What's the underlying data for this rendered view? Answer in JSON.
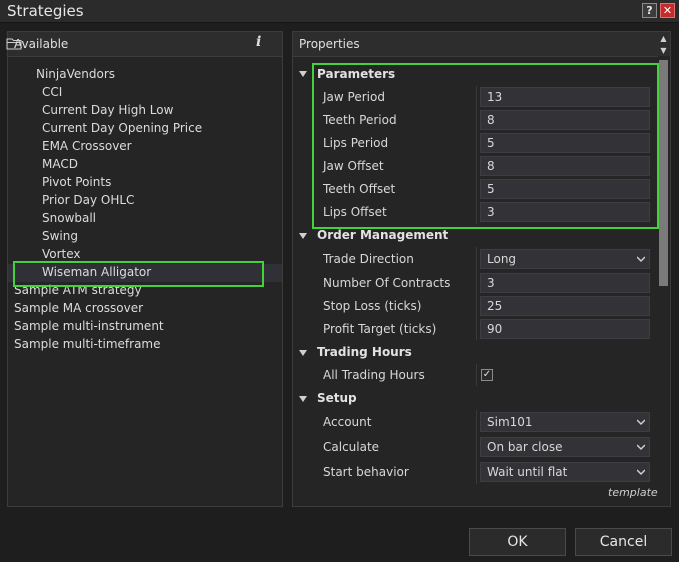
{
  "window": {
    "title": "Strategies",
    "help_label": "?",
    "close_label": "✕"
  },
  "available": {
    "header": "Available",
    "info_label": "i",
    "folder": "NinjaVendors",
    "folder_items": [
      "CCI",
      "Current Day High Low",
      "Current Day Opening Price",
      "EMA Crossover",
      "MACD",
      "Pivot Points",
      "Prior Day OHLC",
      "Snowball",
      "Swing",
      "Vortex",
      "Wiseman Alligator"
    ],
    "root_items": [
      "Sample ATM strategy",
      "Sample MA crossover",
      "Sample multi-instrument",
      "Sample multi-timeframe"
    ],
    "selected": "Wiseman Alligator"
  },
  "properties": {
    "header": "Properties",
    "sections": {
      "parameters": {
        "title": "Parameters",
        "rows": [
          {
            "label": "Jaw Period",
            "value": "13"
          },
          {
            "label": "Teeth Period",
            "value": "8"
          },
          {
            "label": "Lips Period",
            "value": "5"
          },
          {
            "label": "Jaw Offset",
            "value": "8"
          },
          {
            "label": "Teeth Offset",
            "value": "5"
          },
          {
            "label": "Lips Offset",
            "value": "3"
          }
        ]
      },
      "order_management": {
        "title": "Order Management",
        "rows": [
          {
            "label": "Trade Direction",
            "value": "Long"
          },
          {
            "label": "Number Of Contracts",
            "value": "3"
          },
          {
            "label": "Stop Loss (ticks)",
            "value": "25"
          },
          {
            "label": "Profit Target (ticks)",
            "value": "90"
          }
        ]
      },
      "trading_hours": {
        "title": "Trading Hours",
        "rows": [
          {
            "label": "All Trading Hours",
            "checked": true,
            "check_glyph": "✓"
          }
        ]
      },
      "setup": {
        "title": "Setup",
        "rows": [
          {
            "label": "Account",
            "value": "Sim101"
          },
          {
            "label": "Calculate",
            "value": "On bar close"
          },
          {
            "label": "Start behavior",
            "value": "Wait until flat"
          }
        ]
      }
    },
    "template_link": "template"
  },
  "buttons": {
    "ok": "OK",
    "cancel": "Cancel"
  },
  "colors": {
    "highlight": "#44d23c",
    "background": "#1e1e1e",
    "panel": "#252526",
    "close_button": "#c42b2b"
  },
  "icons": [
    "help-icon",
    "close-icon",
    "info-icon",
    "folder-icon",
    "collapse-triangle-icon",
    "chevron-down-icon",
    "scroll-up-icon",
    "scroll-down-icon",
    "checkmark-icon"
  ]
}
